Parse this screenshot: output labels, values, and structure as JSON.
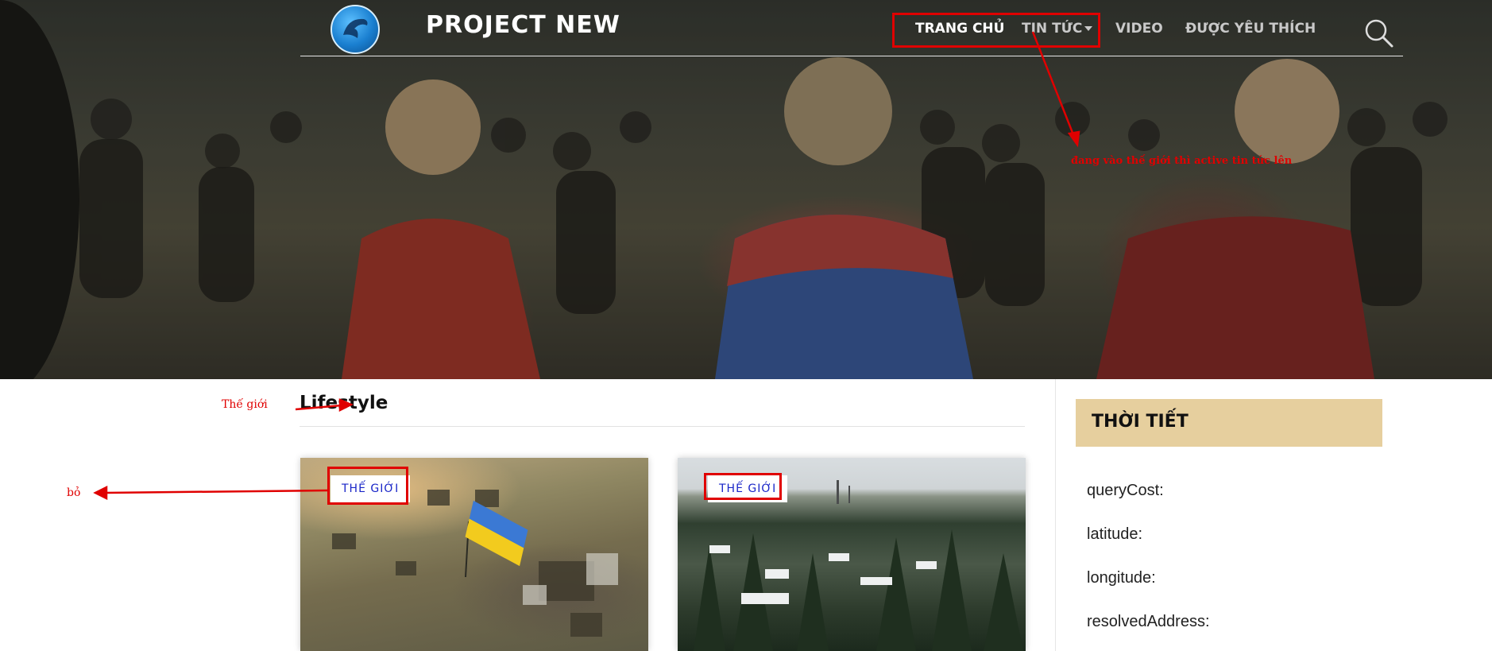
{
  "header": {
    "brand": "PROJECT NEW",
    "nav": {
      "home": "TRANG CHỦ",
      "news": "TIN TỨC",
      "video": "VIDEO",
      "favorites": "ĐƯỢC YÊU THÍCH"
    }
  },
  "annotations": {
    "nav_note": "đang vào thế giới thì active tin tức lên",
    "world_note": "Thế giới",
    "remove_note": "bỏ"
  },
  "content": {
    "section_title": "Lifestyle",
    "cards": [
      {
        "tag": "THẾ GIỚI"
      },
      {
        "tag": "THẾ GIỚI"
      }
    ]
  },
  "weather": {
    "title": "THỜI TIẾT",
    "fields": [
      "queryCost:",
      "latitude:",
      "longitude:",
      "resolvedAddress:"
    ]
  },
  "colors": {
    "annotation_red": "#e00000",
    "tag_text": "#1a26c8",
    "weather_header_bg": "#e6cf9e"
  },
  "icons": {
    "logo": "dolphin-logo-icon",
    "search": "search-icon",
    "dropdown": "caret-down-icon"
  }
}
